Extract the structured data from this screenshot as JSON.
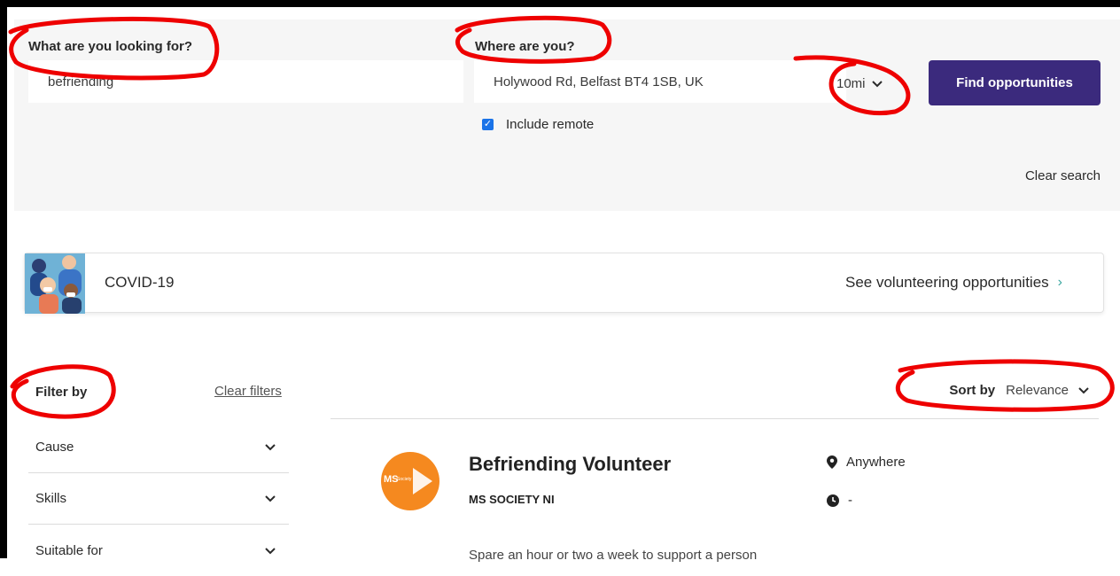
{
  "search": {
    "what_label": "What are you looking for?",
    "what_value": "befriending",
    "where_label": "Where are you?",
    "where_value": "Holywood Rd, Belfast BT4 1SB, UK",
    "radius_value": "10mi",
    "find_button": "Find opportunities",
    "include_remote_label": "Include remote",
    "include_remote_checked": true,
    "clear_search": "Clear search"
  },
  "banner": {
    "title": "COVID-19",
    "link": "See volunteering opportunities",
    "chevron": "›"
  },
  "filters": {
    "title": "Filter by",
    "clear": "Clear filters",
    "items": [
      {
        "label": "Cause"
      },
      {
        "label": "Skills"
      },
      {
        "label": "Suitable for"
      }
    ]
  },
  "sort": {
    "label": "Sort by",
    "value": "Relevance"
  },
  "result": {
    "logo_text": "MS",
    "logo_sub": "Society",
    "title": "Befriending Volunteer",
    "org": "MS SOCIETY NI",
    "location": "Anywhere",
    "time": "-",
    "description": "Spare an hour or two a week to support a person"
  },
  "colors": {
    "accent": "#3b2a7d",
    "annotation": "#ee0000",
    "logo": "#f5891f",
    "teal": "#3ba7a0"
  }
}
